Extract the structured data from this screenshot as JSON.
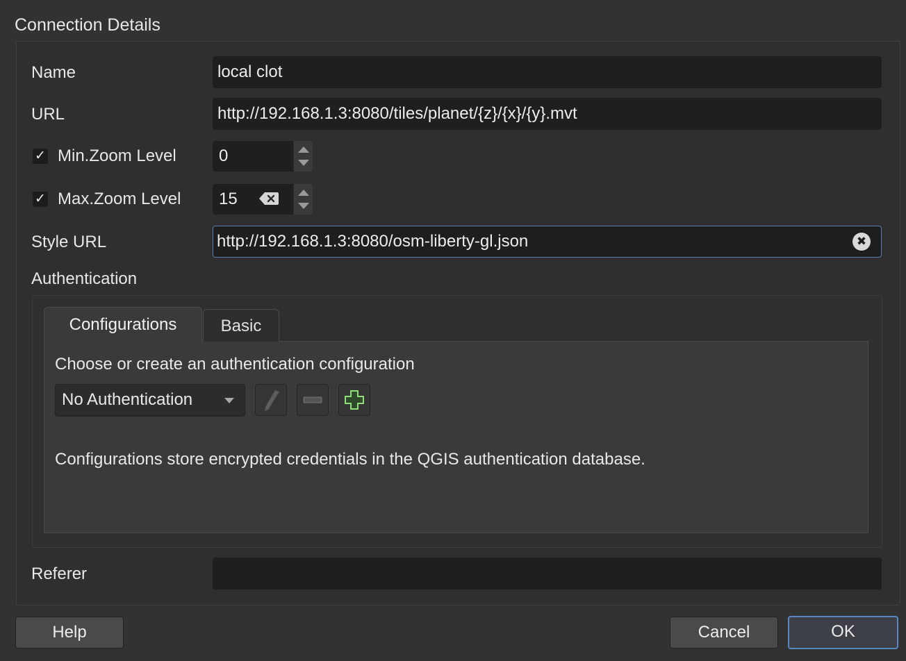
{
  "group": {
    "title": "Connection Details"
  },
  "form": {
    "name": {
      "label": "Name",
      "value": "local clot"
    },
    "url": {
      "label": "URL",
      "value": "http://192.168.1.3:8080/tiles/planet/{z}/{x}/{y}.mvt"
    },
    "min_zoom": {
      "label": "Min.Zoom Level",
      "checked": true,
      "check_glyph": "✓",
      "value": "0"
    },
    "max_zoom": {
      "label": "Max.Zoom Level",
      "checked": true,
      "check_glyph": "✓",
      "value": "15"
    },
    "style_url": {
      "label": "Style URL",
      "value": "http://192.168.1.3:8080/osm-liberty-gl.json",
      "clear_glyph": "✖"
    },
    "referer": {
      "label": "Referer",
      "value": ""
    }
  },
  "auth": {
    "title": "Authentication",
    "tabs": [
      {
        "label": "Configurations",
        "active": true
      },
      {
        "label": "Basic",
        "active": false
      }
    ],
    "prompt": "Choose or create an authentication configuration",
    "select": {
      "value": "No Authentication"
    },
    "icons": [
      "pencil-icon",
      "minus-icon",
      "plus-icon"
    ],
    "info": "Configurations store encrypted credentials in the QGIS authentication database."
  },
  "buttons": {
    "help": "Help",
    "cancel": "Cancel",
    "ok": "OK"
  },
  "colors": {
    "background": "#323232",
    "field": "#1f1f1f",
    "focus": "#5a7fb0",
    "plus_icon": "#7fcf6a"
  }
}
